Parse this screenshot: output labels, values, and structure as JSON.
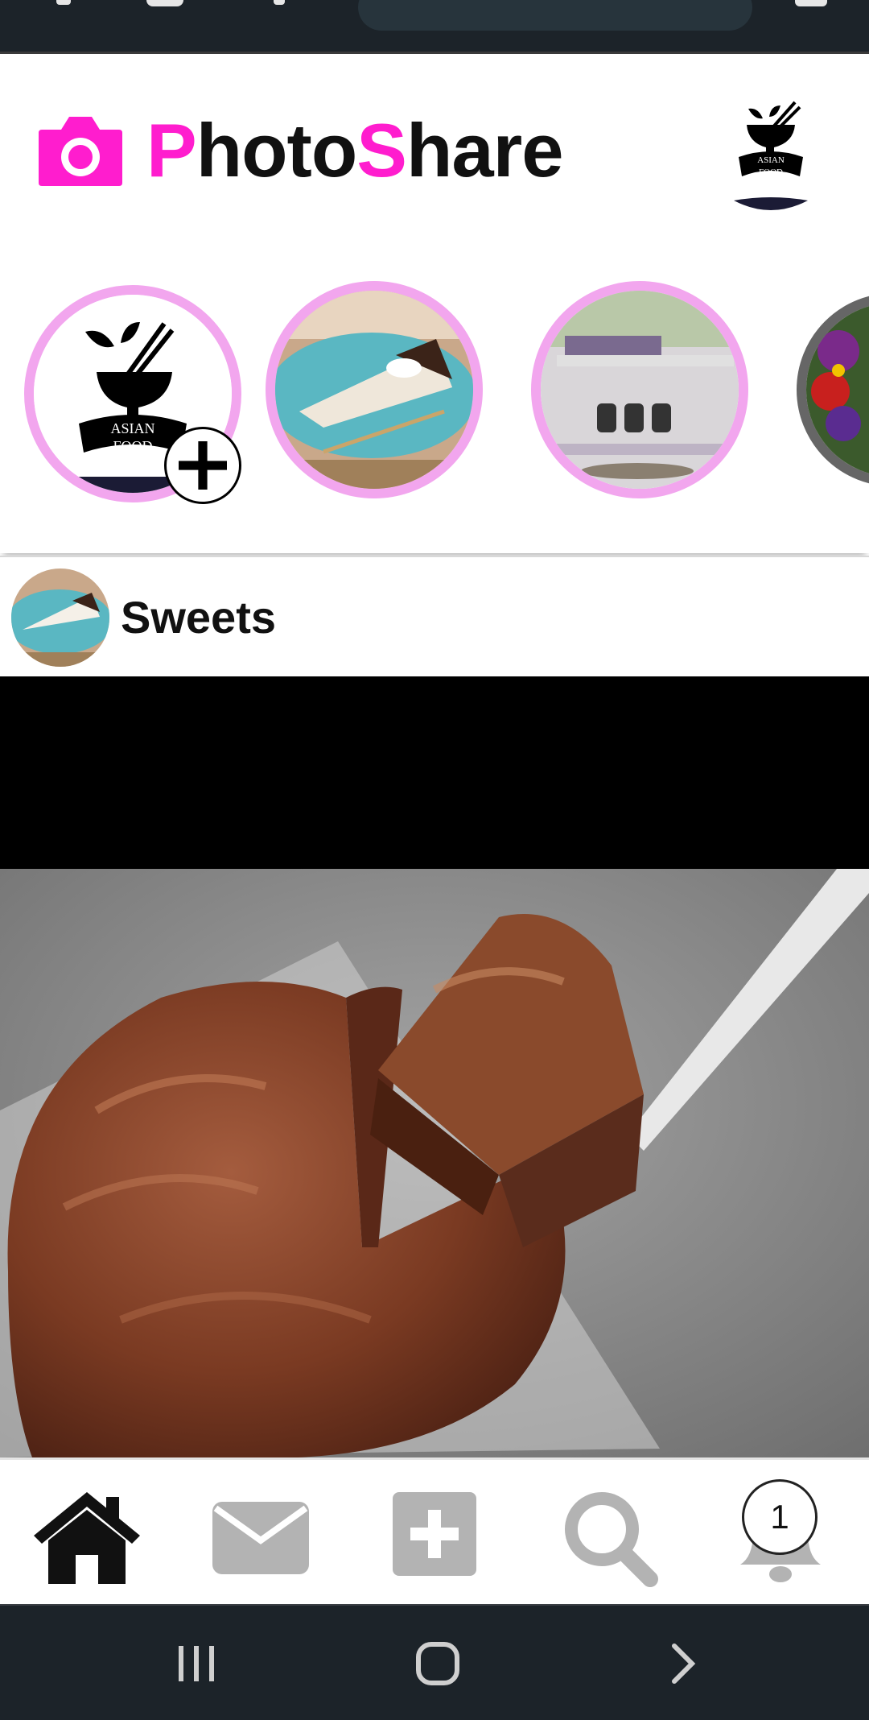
{
  "app": {
    "title_part1_accent": "P",
    "title_part1": "hoto",
    "title_part2_accent": "S",
    "title_part2": "hare",
    "accent_color": "#ff1dce"
  },
  "header": {
    "profile_logo_text_top": "ASIAN",
    "profile_logo_text_bottom": "FOOD"
  },
  "stories": [
    {
      "kind": "own-story",
      "logo_top": "ASIAN",
      "logo_bottom": "FOOD",
      "add_icon": "plus-icon"
    },
    {
      "kind": "story",
      "image": "cookies-and-cream pie slice"
    },
    {
      "kind": "story",
      "image": "shelf with plants and jars"
    },
    {
      "kind": "story-seen",
      "image": "flowers"
    }
  ],
  "post": {
    "author": "Sweets",
    "image": "chocolate frosted cake with slice"
  },
  "nav": {
    "home_icon": "home-icon",
    "messages_icon": "envelope-icon",
    "add_icon": "plus-square-icon",
    "search_icon": "search-icon",
    "notifications_icon": "bell-icon",
    "notification_count": "1",
    "active_color": "#111111",
    "inactive_color": "#b3b3b3"
  },
  "system_nav": {
    "recents_icon": "recents-icon",
    "home_icon": "home-circle-icon",
    "back_icon": "chevron-right-icon"
  }
}
